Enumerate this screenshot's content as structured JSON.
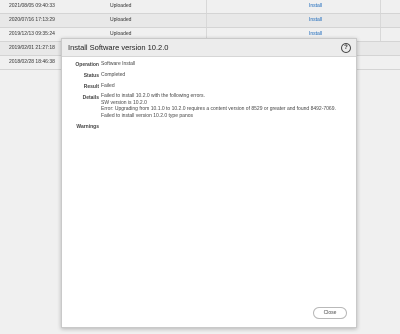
{
  "background_table": {
    "rows": [
      {
        "date": "2021/08/05 09:40:33",
        "status": "Uploaded",
        "action": "Install"
      },
      {
        "date": "2020/07/16 17:13:29",
        "status": "Uploaded",
        "action": "Install"
      },
      {
        "date": "2019/12/13 09:35:24",
        "status": "Uploaded",
        "action": "Install"
      },
      {
        "date": "2019/02/01 21:27:18",
        "status": "",
        "action": ""
      },
      {
        "date": "2018/02/28 18:46:38",
        "status": "",
        "action": ""
      }
    ]
  },
  "dialog": {
    "title": "Install Software version 10.2.0",
    "help_icon": "?",
    "fields": {
      "operation": {
        "label": "Operation",
        "value": "Software Install"
      },
      "status": {
        "label": "Status",
        "value": "Completed"
      },
      "result": {
        "label": "Result",
        "value": "Failed"
      },
      "details": {
        "label": "Details",
        "lines": [
          "Failed to install 10.2.0 with the following errors.",
          "SW version is 10.2.0",
          "Error: Upgrading from 10.1.0 to 10.2.0 requires a content version of 8529 or greater and found 8492-7069.",
          "Failed to install version 10.2.0 type panos"
        ]
      },
      "warnings": {
        "label": "Warnings",
        "value": ""
      }
    },
    "close_label": "Close"
  }
}
